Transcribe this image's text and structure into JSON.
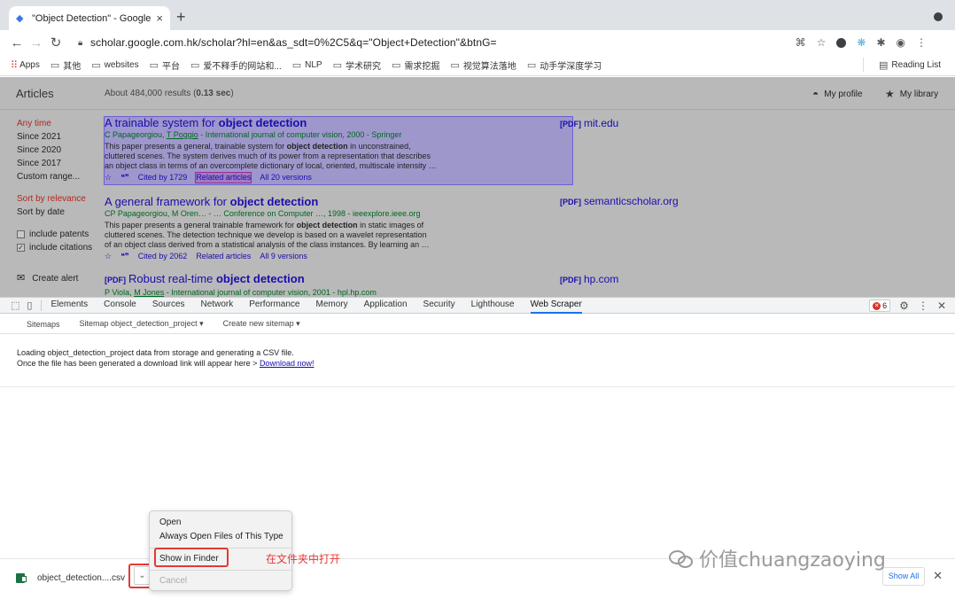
{
  "browser": {
    "tab_title": "\"Object Detection\" - Google Sc",
    "new_tab_symbol": "+",
    "url": "scholar.google.com.hk/scholar?hl=en&as_sdt=0%2C5&q=\"Object+Detection\"&btnG=",
    "bookmarks": [
      "Apps",
      "其他",
      "websites",
      "平台",
      "爱不释手的网站和...",
      "NLP",
      "学术研究",
      "需求挖掘",
      "视觉算法落地",
      "动手学深度学习"
    ],
    "reading_list": "Reading List"
  },
  "scholar": {
    "articles_label": "Articles",
    "results_prefix": "About 484,000 results (",
    "results_time": "0.13 sec",
    "results_suffix": ")",
    "my_profile": "My profile",
    "my_library": "My library",
    "sidebar": {
      "time_filters": [
        "Any time",
        "Since 2021",
        "Since 2020",
        "Since 2017",
        "Custom range..."
      ],
      "sort_options": [
        "Sort by relevance",
        "Sort by date"
      ],
      "include_patents": "include patents",
      "include_citations": "include citations",
      "create_alert": "Create alert"
    },
    "results": [
      {
        "title_plain": "A trainable system for ",
        "title_bold": "object detection",
        "pdf_tag": "",
        "authors_a": "C Papageorgiou, ",
        "authors_u": "T Poggio",
        "authors_b": " - International journal of computer vision, 2000 - Springer",
        "snippet_1a": "This paper presents a general, trainable system for ",
        "snippet_1b": "object detection",
        "snippet_1c": " in unconstrained,",
        "snippet_2": "cluttered scenes. The system derives much of its power from a representation that describes",
        "snippet_3": "an object class in terms of an overcomplete dictionary of local, oriented, multiscale intensity …",
        "cited": "Cited by 1729",
        "related": "Related articles",
        "versions": "All 20 versions",
        "side_tag": "[PDF]",
        "side_host": "mit.edu"
      },
      {
        "title_plain": "A general framework for ",
        "title_bold": "object detection",
        "pdf_tag": "",
        "authors_a": "CP Papageorgiou, M Oren… - … Conference on Computer …, 1998 - ieeexplore.ieee.org",
        "authors_u": "",
        "authors_b": "",
        "snippet_1a": "This paper presents a general trainable framework for ",
        "snippet_1b": "object detection",
        "snippet_1c": " in static images of",
        "snippet_2": "cluttered scenes. The detection technique we develop is based on a wavelet representation",
        "snippet_3": "of an object class derived from a statistical analysis of the class instances. By learning an …",
        "cited": "Cited by 2062",
        "related": "Related articles",
        "versions": "All 9 versions",
        "side_tag": "[PDF]",
        "side_host": "semanticscholar.org"
      },
      {
        "title_plain": "Robust real-time ",
        "title_bold": "object detection",
        "pdf_tag": "[PDF]",
        "authors_a": "P Viola, ",
        "authors_u": "M Jones",
        "authors_b": " - International journal of computer vision, 2001 - hpl.hp.com",
        "side_tag": "[PDF]",
        "side_host": "hp.com"
      }
    ]
  },
  "devtools": {
    "tabs": [
      "Elements",
      "Console",
      "Sources",
      "Network",
      "Performance",
      "Memory",
      "Application",
      "Security",
      "Lighthouse",
      "Web Scraper"
    ],
    "active_tab": "Web Scraper",
    "error_count": "6",
    "ws_nav": [
      "Sitemaps",
      "Sitemap object_detection_project ▾",
      "Create new sitemap ▾"
    ],
    "message_1": "Loading object_detection_project data from storage and generating a CSV file.",
    "message_2": "Once the file has been generated a download link will appear here > ",
    "download_link": "Download now!"
  },
  "download": {
    "filename": "object_detection....csv",
    "show_all": "Show All",
    "menu": [
      "Open",
      "Always Open Files of This Type",
      "Show in Finder",
      "Cancel"
    ],
    "annotation": "在文件夹中打开"
  },
  "watermark": "价值chuangzaoying",
  "colors": {
    "link": "#1a0dab",
    "author_green": "#006621",
    "annotation_red": "#e53935",
    "active_filter": "#b3261e",
    "highlight": "#897cdc"
  }
}
